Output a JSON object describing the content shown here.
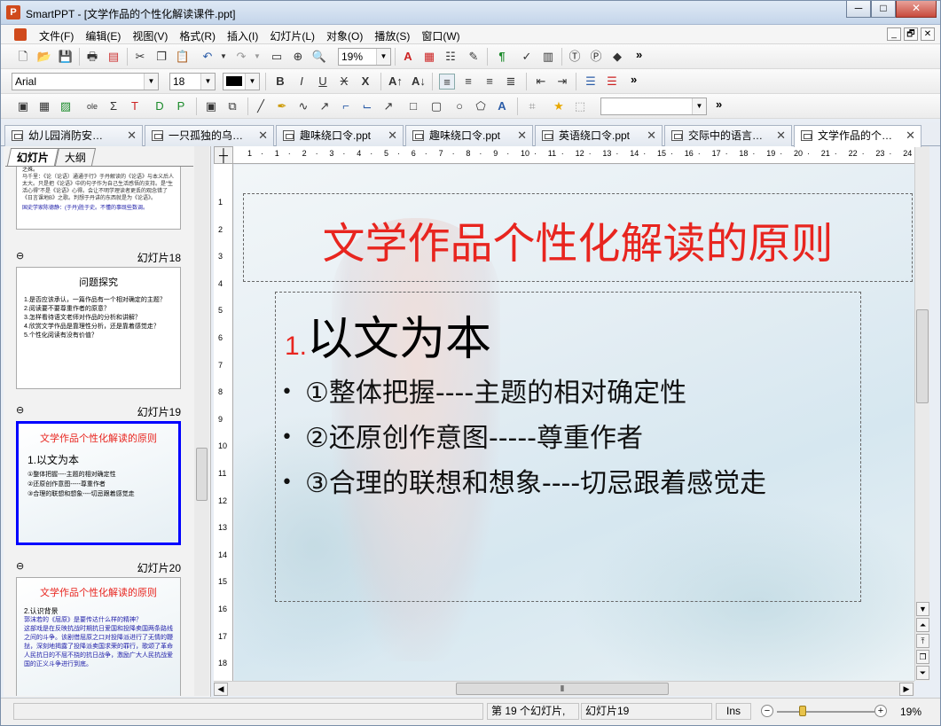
{
  "window": {
    "title": "SmartPPT - [文学作品的个性化解读课件.ppt]",
    "app_icon": "P",
    "minimize": "─",
    "maximize": "□",
    "close": "✕"
  },
  "menu": {
    "items": [
      "文件(F)",
      "编辑(E)",
      "视图(V)",
      "格式(R)",
      "插入(I)",
      "幻灯片(L)",
      "对象(O)",
      "播放(S)",
      "窗口(W)"
    ]
  },
  "mdi_buttons": [
    "_",
    "🗗",
    "✕"
  ],
  "toolbar": {
    "zoom": "19%",
    "font": "Arial",
    "font_size": "18",
    "more": "»"
  },
  "doc_tabs": [
    {
      "label": "幼儿园消防安…",
      "active": false
    },
    {
      "label": "一只孤独的乌…",
      "active": false
    },
    {
      "label": "趣味绕口令.ppt",
      "active": false
    },
    {
      "label": "趣味绕口令.ppt",
      "active": false
    },
    {
      "label": "英语绕口令.ppt",
      "active": false
    },
    {
      "label": "交际中的语言…",
      "active": false
    },
    {
      "label": "文学作品的个…",
      "active": true
    }
  ],
  "left_tabs": {
    "slides": "幻灯片",
    "outline": "大纲"
  },
  "thumbnails": {
    "t17": {
      "lines": [
        "之殊。",
        "马千里：《论（论语）通通于行》于丹解读的《论语》与本义后人太大。只是把《论语》中的句子作为自己生活感悟的支持。是“生活心得”不是《论语》心得。会让不明学理读者更丢的观念错了《日言课地B》之歌。判想于丹讲的东西就是为《论语》。",
        "国史学家陈德静：(于丹)胜于史。不懂的事既些数调。"
      ]
    },
    "t18": {
      "label": "幻灯片18",
      "title": "问题探究",
      "items": [
        "1.是否应该承认，一篇作品有一个相对确定的主题？",
        "2.阅读要不要尊重作者的原意？",
        "3.怎样看待语文老师对作品的分析和讲解？",
        "4.欣赏文学作品是靠理性分析，还是靠着感觉走？",
        "5.个性化阅读有没有价值？"
      ]
    },
    "t19": {
      "label": "幻灯片19",
      "title": "文学作品个性化解读的原则",
      "heading": "1.以文为本",
      "items": [
        "①整体把握----主题的相对确定性",
        "②还原创作意图-----尊重作者",
        "③合理的联想和想象----切忌跟着感觉走"
      ]
    },
    "t20": {
      "label": "幻灯片20",
      "title": "文学作品个性化解读的原则",
      "heading": "2.认识背景",
      "items": [
        "郭沫若的《屈原》是要传达什么样的精神？",
        "这部戏是在反映抗战时期抗日爱国和投降卖国两条路线之间的斗争。该剧借屈原之口对投降派进行了无情的鞭挞，深刻地揭露了投降派卖国求荣的罪行，歌颂了革命人民抗日的不屈不挠的抗日战争，激励广大人民抗战爱国的正义斗争进行到底。"
      ]
    }
  },
  "slide": {
    "title": "文学作品个性化解读的原则",
    "heading_num": "1.",
    "heading_text": "以文为本",
    "bullets": [
      "①整体把握----主题的相对确定性",
      "②还原创作意图-----尊重作者",
      "③合理的联想和想象----切忌跟着感觉走"
    ],
    "bullet_mark": "•"
  },
  "ruler_h": [
    "1",
    "1",
    "2",
    "3",
    "4",
    "5",
    "6",
    "7",
    "8",
    "9",
    "10",
    "11",
    "12",
    "13",
    "14",
    "15",
    "16",
    "17",
    "18",
    "19",
    "20",
    "21",
    "22",
    "23",
    "24",
    "25"
  ],
  "ruler_v": [
    "1",
    "2",
    "3",
    "4",
    "5",
    "6",
    "7",
    "8",
    "9",
    "10",
    "11",
    "12",
    "13",
    "14",
    "15",
    "16",
    "17",
    "18"
  ],
  "status": {
    "slide_pos": "第 19 个幻灯片,",
    "slide_name": "幻灯片19",
    "ins": "Ins",
    "zoom": "19%",
    "zoom_minus": "−",
    "zoom_plus": "+"
  },
  "colors": {
    "title_red": "#e8251f",
    "selection_blue": "#0000ff"
  }
}
